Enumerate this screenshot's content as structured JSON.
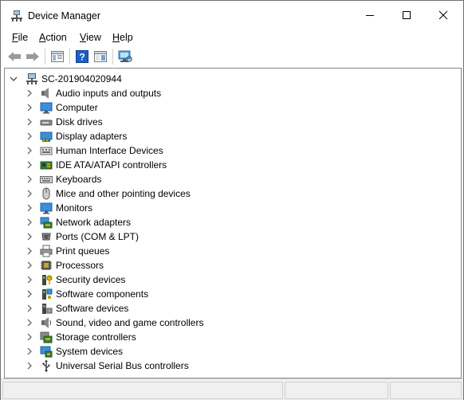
{
  "window": {
    "title": "Device Manager",
    "icons": {
      "app": "device-manager-icon",
      "minimize": "minimize-icon",
      "maximize": "maximize-icon",
      "close": "close-icon"
    }
  },
  "menu": {
    "items": [
      {
        "label": "File"
      },
      {
        "label": "Action"
      },
      {
        "label": "View"
      },
      {
        "label": "Help"
      }
    ]
  },
  "toolbar": {
    "buttons": [
      {
        "icon": "back-arrow-icon"
      },
      {
        "icon": "forward-arrow-icon"
      },
      {
        "icon": "properties-icon"
      },
      {
        "icon": "help-icon"
      },
      {
        "icon": "show-hide-pane-icon"
      },
      {
        "icon": "scan-hardware-icon"
      }
    ]
  },
  "tree": {
    "root": {
      "label": "SC-201904020944",
      "icon": "computer-icon",
      "expanded": true
    },
    "categories": [
      {
        "label": "Audio inputs and outputs",
        "icon": "speaker-icon"
      },
      {
        "label": "Computer",
        "icon": "monitor-icon"
      },
      {
        "label": "Disk drives",
        "icon": "disk-drive-icon"
      },
      {
        "label": "Display adapters",
        "icon": "display-adapter-icon"
      },
      {
        "label": "Human Interface Devices",
        "icon": "hid-icon"
      },
      {
        "label": "IDE ATA/ATAPI controllers",
        "icon": "ide-controller-icon"
      },
      {
        "label": "Keyboards",
        "icon": "keyboard-icon"
      },
      {
        "label": "Mice and other pointing devices",
        "icon": "mouse-icon"
      },
      {
        "label": "Monitors",
        "icon": "monitor-icon"
      },
      {
        "label": "Network adapters",
        "icon": "network-adapter-icon"
      },
      {
        "label": "Ports (COM & LPT)",
        "icon": "port-icon"
      },
      {
        "label": "Print queues",
        "icon": "printer-icon"
      },
      {
        "label": "Processors",
        "icon": "processor-icon"
      },
      {
        "label": "Security devices",
        "icon": "security-device-icon"
      },
      {
        "label": "Software components",
        "icon": "software-component-icon"
      },
      {
        "label": "Software devices",
        "icon": "software-device-icon"
      },
      {
        "label": "Sound, video and game controllers",
        "icon": "sound-icon"
      },
      {
        "label": "Storage controllers",
        "icon": "storage-controller-icon"
      },
      {
        "label": "System devices",
        "icon": "system-devices-icon"
      },
      {
        "label": "Universal Serial Bus controllers",
        "icon": "usb-icon"
      }
    ]
  },
  "colors": {
    "accent": "#0078d7",
    "border": "#828790",
    "statusbar": "#f0f0f0"
  }
}
